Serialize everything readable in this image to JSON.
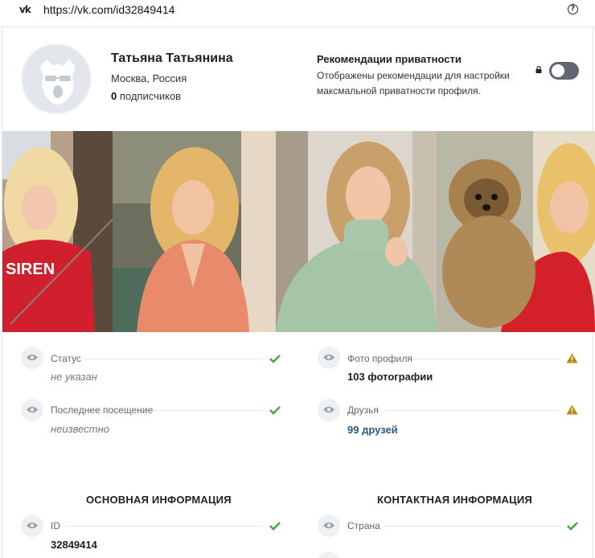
{
  "urlbar": {
    "url": "https://vk.com/id32849414",
    "help_glyph": "?"
  },
  "profile": {
    "name": "Татьяна Татьянина",
    "city": "Москва, Россия",
    "subscribers_count": "0",
    "subscribers_label": "подписчиков"
  },
  "privacy": {
    "title": "Рекомендации приватности",
    "description": "Отображены рекомендации для настройки максмальной приватности профиля.",
    "toggle_on": false
  },
  "photos": [
    {
      "name": "photo-1"
    },
    {
      "name": "photo-2"
    },
    {
      "name": "photo-3"
    },
    {
      "name": "photo-4"
    }
  ],
  "info": {
    "status_label": "Статус",
    "status_value": "не указан",
    "last_seen_label": "Последнее посещение",
    "last_seen_value": "неизвестно",
    "photo_label": "Фото профиля",
    "photo_value": "103 фотографии",
    "friends_label": "Друзья",
    "friends_value": "99 друзей"
  },
  "sections": {
    "basic_title": "ОСНОВНАЯ ИНФОРМАЦИЯ",
    "contact_title": "КОНТАКТНАЯ ИНФОРМАЦИЯ",
    "id_label": "ID",
    "id_value": "32849414",
    "country_label": "Страна"
  },
  "colors": {
    "check": "#3fa843",
    "warn": "#b8861b",
    "link": "#2a5885",
    "toggle": "#5e6772"
  }
}
